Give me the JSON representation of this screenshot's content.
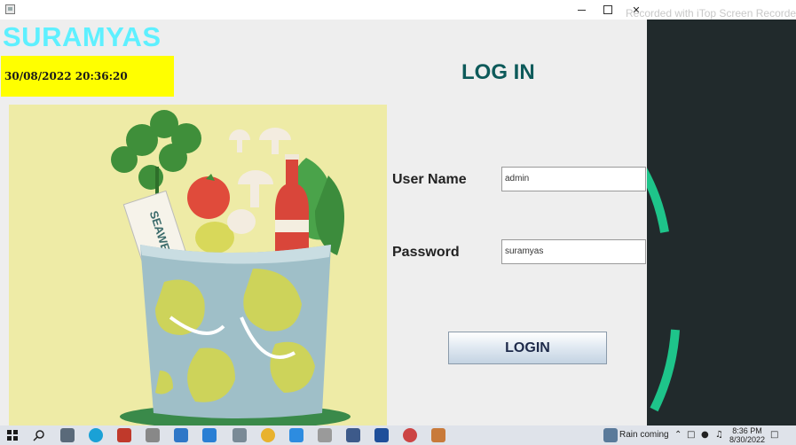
{
  "window": {
    "recorder_watermark": "Recorded with iTop Screen Recorder"
  },
  "app": {
    "brand": "SURAMYAS",
    "datetime": "30/08/2022 20:36:20",
    "title": "LOG IN"
  },
  "form": {
    "username_label": "User Name",
    "username_value": "admin",
    "password_label": "Password",
    "password_value": "suramyas",
    "login_button": "LOGIN"
  },
  "illustration": {
    "bag_text": "SEAWEED"
  },
  "taskbar": {
    "weather": "Rain coming",
    "time": "8:36 PM",
    "date": "8/30/2022"
  },
  "colors": {
    "brand": "#5ef0ff",
    "date_bg": "#ffff00",
    "title": "#0d5a5a",
    "accent_ring": "#1ec48a"
  }
}
